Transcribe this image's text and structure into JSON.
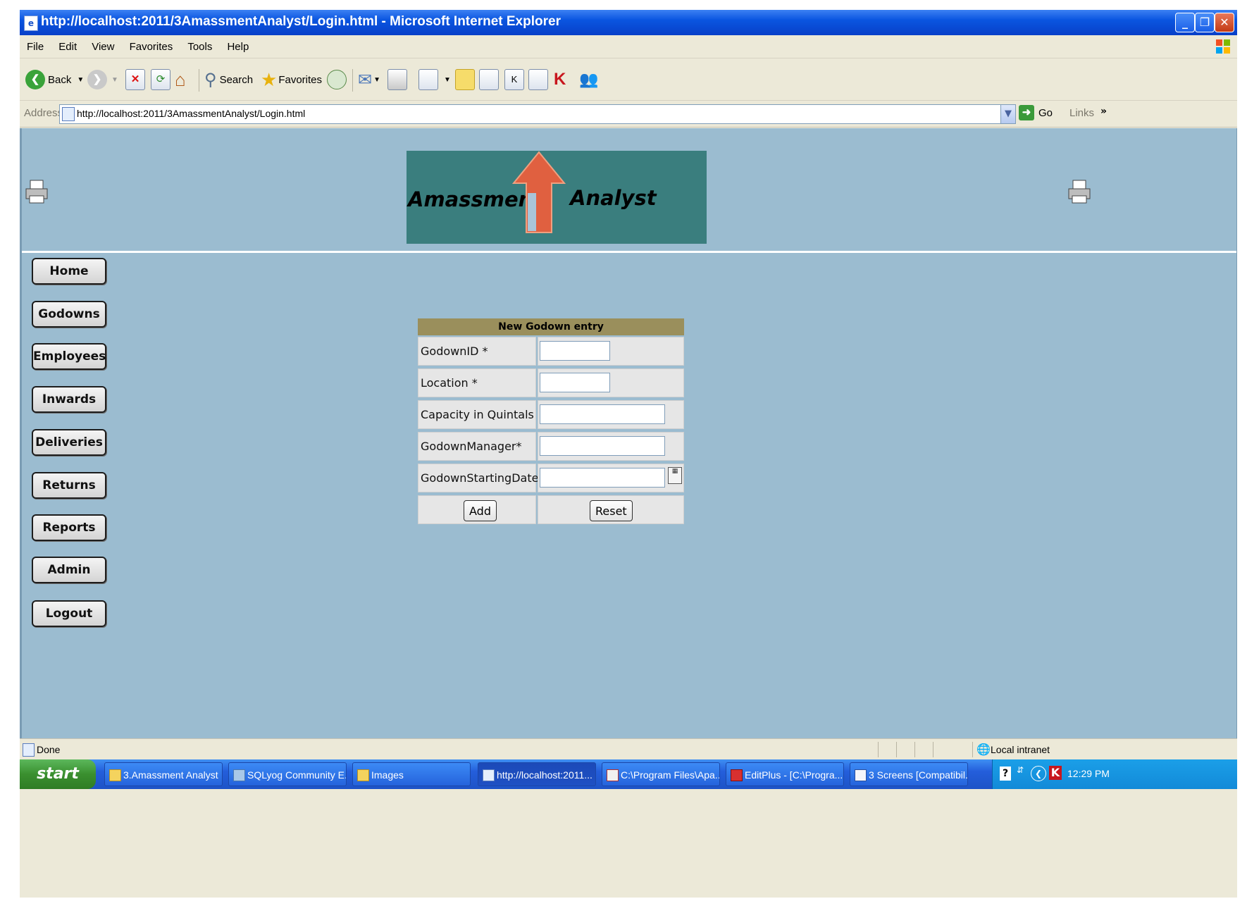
{
  "window": {
    "title": "http://localhost:2011/3AmassmentAnalyst/Login.html - Microsoft Internet Explorer"
  },
  "menu": [
    "File",
    "Edit",
    "View",
    "Favorites",
    "Tools",
    "Help"
  ],
  "toolbar": {
    "back_label": "Back",
    "search_label": "Search",
    "favorites_label": "Favorites"
  },
  "address": {
    "label": "Address",
    "url": "http://localhost:2011/3AmassmentAnalyst/Login.html",
    "go_label": "Go",
    "links_label": "Links"
  },
  "logo": {
    "word1": "Amassment",
    "word2": "Analyst"
  },
  "nav": [
    "Home",
    "Godowns",
    "Employees",
    "Inwards",
    "Deliveries",
    "Returns",
    "Reports",
    "Admin",
    "Logout"
  ],
  "form": {
    "title": "New Godown entry",
    "fields": [
      {
        "label": "GodownID *",
        "value": ""
      },
      {
        "label": "Location *",
        "value": ""
      },
      {
        "label": "Capacity in Quintals *",
        "value": ""
      },
      {
        "label": "GodownManager*",
        "value": ""
      },
      {
        "label": "GodownStartingDate*",
        "value": ""
      }
    ],
    "add_label": "Add",
    "reset_label": "Reset"
  },
  "status": {
    "text": "Done",
    "zone": "Local intranet"
  },
  "taskbar": {
    "start_label": "start",
    "tasks": [
      "3.Amassment Analyst",
      "SQLyog Community E...",
      "Images",
      "http://localhost:2011...",
      "C:\\Program Files\\Apa...",
      "EditPlus - [C:\\Progra...",
      "3 Screens [Compatibil..."
    ],
    "clock": "12:29 PM"
  },
  "colors": {
    "page_bg": "#9bbcd0",
    "logo_bg": "#3a7e7e",
    "form_header": "#9a8f5c"
  }
}
